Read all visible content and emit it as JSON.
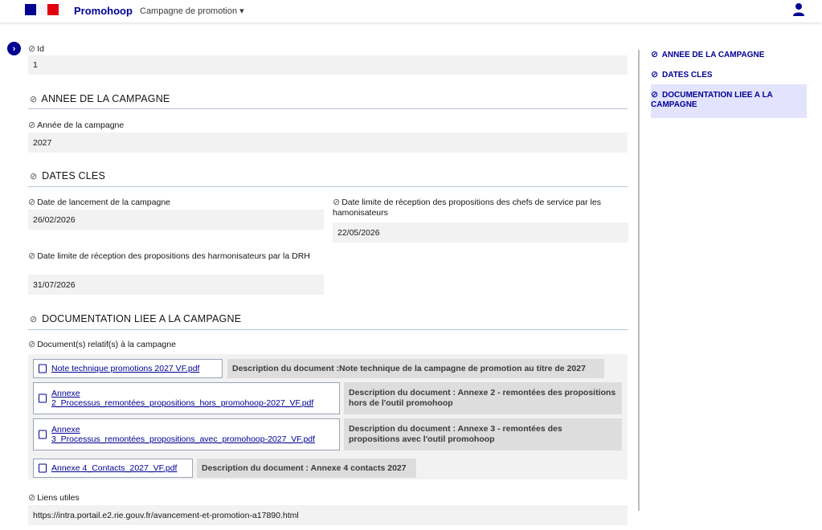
{
  "header": {
    "brand": "Promohoop",
    "campaign_menu": "Campagne de promotion ▾"
  },
  "fields": {
    "id_label": "Id",
    "id_value": "1",
    "annee_label": "Année de la campagne",
    "annee_value": "2027",
    "date_lancement_label": "Date de lancement de la campagne",
    "date_lancement_value": "26/02/2026",
    "date_limite_chefs_label": "Date limite de réception des propositions des chefs de service par les hamonisateurs",
    "date_limite_chefs_value": "22/05/2026",
    "date_limite_drh_label": "Date limite de réception des propositions des harmonisateurs par la DRH",
    "date_limite_drh_value": "31/07/2026",
    "documents_label": "Document(s) relatif(s) à la campagne",
    "liens_label": "Liens utiles",
    "liens_value": "https://intra.portail.e2.rie.gouv.fr/avancement-et-promotion-a17890.html"
  },
  "sections": {
    "annee": "ANNEE DE LA CAMPAGNE",
    "dates": "DATES CLES",
    "documentation": "DOCUMENTATION LIEE A LA CAMPAGNE"
  },
  "documents": [
    {
      "link": "Note technique promotions 2027 VF.pdf",
      "desc_prefix": "Description du document : ",
      "desc": "Note technique de la campagne de promotion au titre de 2027"
    },
    {
      "link_line1": "Annexe",
      "link_line2": "2_Processus_remontées_propositions_hors_promohoop-2027_VF.pdf",
      "desc_line1": "Description du document : Annexe 2 - remontées des propositions",
      "desc_line2": "hors de l'outil promohoop"
    },
    {
      "link_line1": "Annexe",
      "link_line2": "3_Processus_remontées_propositions_avec_promohoop-2027_VF.pdf",
      "desc_line1": "Description du document : Annexe 3 - remontées des",
      "desc_line2": "propositions avec l'outil promohoop"
    },
    {
      "link": "Annexe 4_Contacts_2027_VF.pdf",
      "desc": "Description du document : Annexe 4 contacts 2027"
    }
  ],
  "toc": {
    "item1": "ANNEE DE LA CAMPAGNE",
    "item2": "DATES CLES",
    "item3_line1": "DOCUMENTATION LIEE A LA",
    "item3_line2": "CAMPAGNE"
  },
  "icons": {
    "tag": "tag-icon",
    "user": "user-icon",
    "file": "file-icon",
    "chevron": "chevron-right-icon"
  },
  "colors": {
    "primary": "#000091",
    "flag_red": "#e1000f",
    "field_bg": "#f2f2f2",
    "toc_active_bg": "#e3e3fd"
  }
}
